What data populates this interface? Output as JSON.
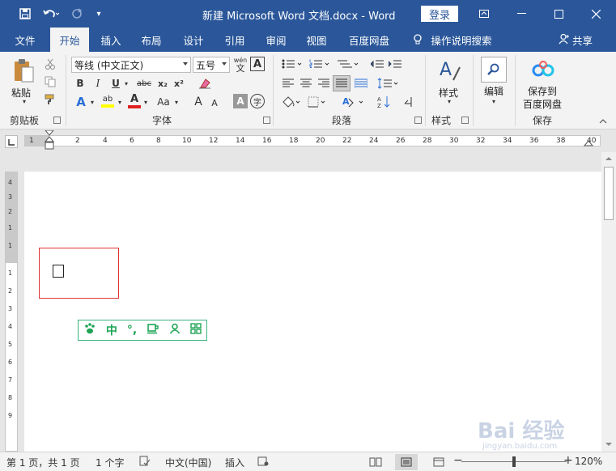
{
  "window": {
    "title": "新建 Microsoft Word 文档.docx  -  Word",
    "login": "登录",
    "colors": {
      "accent": "#2b579a",
      "ribbon_bg": "#f3f3f3",
      "textbox_border": "#dd3333",
      "ime_green": "#1fa456"
    }
  },
  "tabs": [
    "文件",
    "开始",
    "插入",
    "布局",
    "设计",
    "引用",
    "审阅",
    "视图",
    "百度网盘",
    "操作说明搜索"
  ],
  "active_tab": "开始",
  "share": "共享",
  "ribbon": {
    "clipboard": {
      "paste": "粘贴",
      "label": "剪贴板"
    },
    "font": {
      "font_name": "等线 (中文正文)",
      "font_size": "五号",
      "label": "字体",
      "wen": "wén",
      "wen_char": "文",
      "a_box": "A",
      "bold": "B",
      "italic": "I",
      "underline": "U",
      "strike": "abc",
      "sub": "x₂",
      "sup": "x²",
      "font_color": "A",
      "aa": "Aa",
      "grow": "A",
      "shrink": "A",
      "char_shade": "A",
      "enclose": "字",
      "highlight_text": "ab"
    },
    "paragraph": {
      "label": "段落"
    },
    "styles": {
      "title": "样式",
      "label": "样式"
    },
    "editing": {
      "title": "编辑"
    },
    "baidu": {
      "title_line1": "保存到",
      "title_line2": "百度网盘",
      "label": "保存"
    }
  },
  "ruler": {
    "marks": [
      "1",
      "2",
      "4",
      "6",
      "8",
      "10",
      "12",
      "14",
      "16",
      "18",
      "20",
      "22",
      "24",
      "26",
      "28",
      "30",
      "32",
      "34",
      "36",
      "38",
      "40"
    ],
    "vmarks": [
      "4",
      "3",
      "2",
      "1",
      "1",
      "1",
      "2",
      "3",
      "4",
      "5",
      "6",
      "7",
      "8",
      "9"
    ]
  },
  "ime": {
    "middle": "中",
    "punct": "°,"
  },
  "watermark": {
    "main": "Bai 经验",
    "sub": "jingyan.baidu.com"
  },
  "status": {
    "page": "第 1 页，共 1 页",
    "words": "1 个字",
    "language": "中文(中国)",
    "mode": "插入",
    "zoom": "120%"
  }
}
